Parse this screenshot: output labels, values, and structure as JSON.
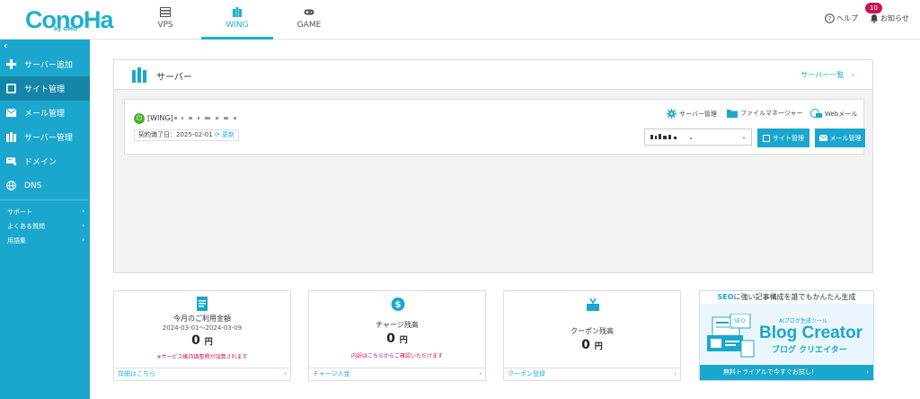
{
  "brand": {
    "logo": "ConoHa",
    "logo_sub": "by GMO"
  },
  "top_nav": [
    {
      "label": "VPS",
      "icon": "server-stack-icon",
      "active": false
    },
    {
      "label": "WING",
      "icon": "wing-server-icon",
      "active": true
    },
    {
      "label": "GAME",
      "icon": "gamepad-icon",
      "active": false
    }
  ],
  "header_right": {
    "help_label": "ヘルプ",
    "notice_label": "お知らせ",
    "notice_count": "10"
  },
  "sidebar": {
    "collapse_icon": "‹",
    "items": [
      {
        "label": "サーバー追加",
        "icon": "plus-icon",
        "active": false
      },
      {
        "label": "サイト管理",
        "icon": "site-square-icon",
        "active": true
      },
      {
        "label": "メール管理",
        "icon": "envelope-icon",
        "active": false
      },
      {
        "label": "サーバー管理",
        "icon": "server-icon",
        "active": false
      },
      {
        "label": "ドメイン",
        "icon": "domain-card-icon",
        "active": false
      },
      {
        "label": "DNS",
        "icon": "globe-icon",
        "active": false
      }
    ],
    "sub_items": [
      {
        "label": "サポート",
        "arrow": "›"
      },
      {
        "label": "よくある質問",
        "arrow": "›"
      },
      {
        "label": "用語集",
        "arrow": "›"
      }
    ]
  },
  "server_panel": {
    "title": "サーバー",
    "list_link": "サーバー一覧",
    "list_arrow": "›",
    "server": {
      "name": "[WING]",
      "contract_label": "契約満了日：2025-02-01",
      "renew_label": "更新",
      "links": [
        {
          "label": "サーバー管理",
          "icon": "gear-icon"
        },
        {
          "label": "ファイルマネージャー",
          "icon": "folder-icon"
        },
        {
          "label": "Webメール",
          "icon": "webmail-icon"
        }
      ],
      "site_select_value": "",
      "site_button": "サイト管理",
      "mail_button": "メール管理"
    }
  },
  "cards": [
    {
      "title": "今月のご利用金額",
      "period": "2024-03-01〜2024-03-09",
      "amount": "0",
      "unit": "円",
      "note": "※サービス維持調整費が加算されます",
      "footer": "詳細はこちら",
      "icon": "invoice-icon"
    },
    {
      "title": "チャージ残高",
      "amount": "0",
      "unit": "円",
      "note": "内訳はこちらからご確認いただけます",
      "footer": "チャージ入金",
      "icon": "dollar-coin-icon"
    },
    {
      "title": "クーポン残高",
      "amount": "0",
      "unit": "円",
      "footer": "クーポン登録",
      "icon": "coupon-gift-icon"
    }
  ],
  "banner": {
    "top_highlight": "SEO",
    "top_text": "に強い記事構成を誰でもかんたん生成",
    "small": "AIブログ生成ツール",
    "big": "Blog Creator",
    "kana": "ブログ クリエイター",
    "footer": "無料トライアルで今すぐお試し！",
    "arrow": "›"
  },
  "colors": {
    "accent": "#1ba7cd",
    "alert": "#c8145a",
    "power": "#4caf30"
  }
}
